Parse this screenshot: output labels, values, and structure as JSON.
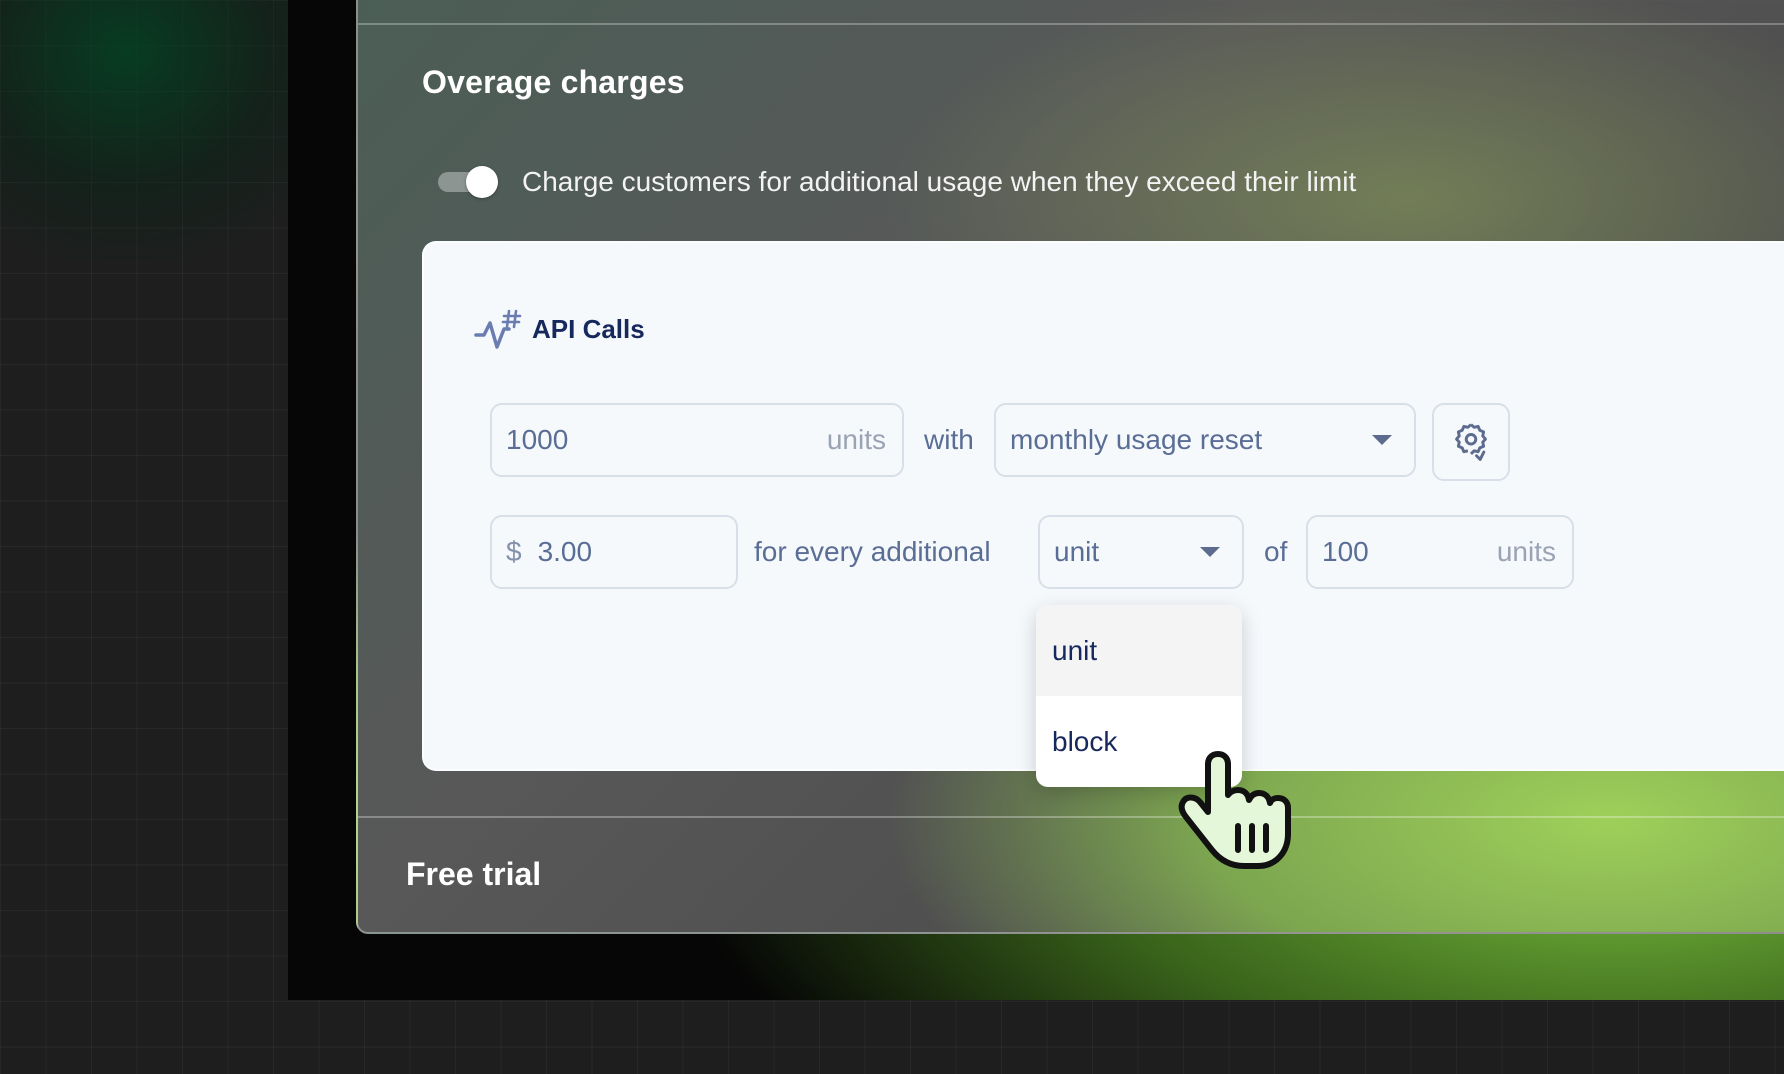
{
  "section": {
    "title": "Overage charges",
    "toggle_label": "Charge customers for additional usage when they exceed their limit",
    "toggle_on": true
  },
  "meter": {
    "name": "API Calls",
    "icon": "activity-hash-icon",
    "limit_value": "1000",
    "limit_suffix": "units",
    "with_text": "with",
    "reset_select": "monthly usage reset",
    "price_prefix": "$",
    "price_value": "3.00",
    "per_text": "for every additional",
    "unit_select": "unit",
    "of_text": "of",
    "block_value": "100",
    "block_suffix": "units"
  },
  "dropdown": {
    "options": [
      "unit",
      "block"
    ],
    "highlighted": "unit"
  },
  "next_section": {
    "title": "Free trial"
  },
  "colors": {
    "accent_green": "#9fcf5f",
    "text_navy": "#17285c",
    "field_text": "#5a6d95",
    "border": "#d9dfe8"
  }
}
